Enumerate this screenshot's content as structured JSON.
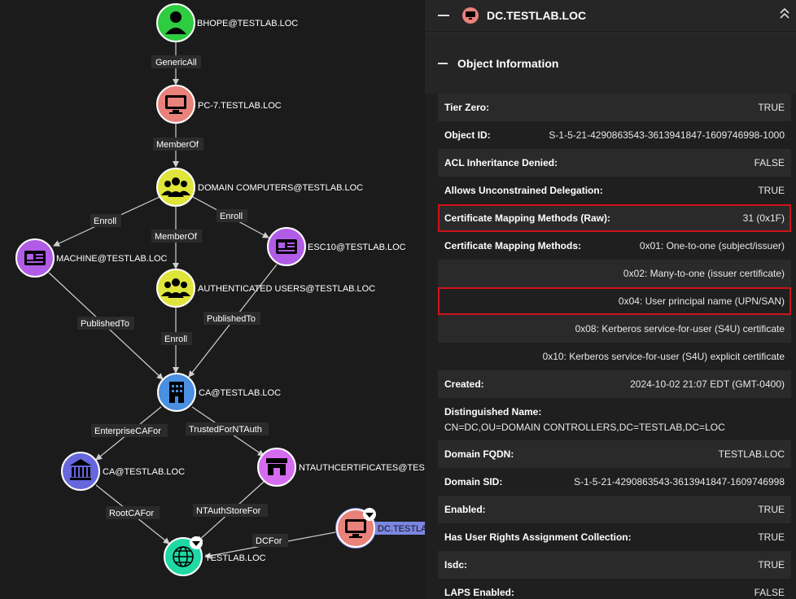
{
  "graph": {
    "nodes": [
      {
        "id": "bhope",
        "label": "BHOPE@TESTLAB.LOC",
        "icon": "user-icon",
        "color": "#2ecc40"
      },
      {
        "id": "pc7",
        "label": "PC-7.TESTLAB.LOC",
        "icon": "computer-icon",
        "color": "#e8827a"
      },
      {
        "id": "dcomp",
        "label": "DOMAIN COMPUTERS@TESTLAB.LOC",
        "icon": "group-icon",
        "color": "#dfe53a"
      },
      {
        "id": "machine",
        "label": "MACHINE@TESTLAB.LOC",
        "icon": "cert-template-icon",
        "color": "#b05ce6"
      },
      {
        "id": "esc10",
        "label": "ESC10@TESTLAB.LOC",
        "icon": "cert-template-icon",
        "color": "#b05ce6"
      },
      {
        "id": "authusers",
        "label": "AUTHENTICATED USERS@TESTLAB.LOC",
        "icon": "group-icon",
        "color": "#dfe53a"
      },
      {
        "id": "ca1",
        "label": "CA@TESTLAB.LOC",
        "icon": "enterprise-ca-icon",
        "color": "#4a8fe0"
      },
      {
        "id": "ca2",
        "label": "CA@TESTLAB.LOC",
        "icon": "root-ca-icon",
        "color": "#6666dd"
      },
      {
        "id": "ntauth",
        "label": "NTAUTHCERTIFICATES@TESTLAB.LOC",
        "icon": "ntauth-store-icon",
        "color": "#d56cf0"
      },
      {
        "id": "domain",
        "label": "TESTLAB.LOC",
        "icon": "domain-icon",
        "color": "#1fd8a4"
      },
      {
        "id": "dc",
        "label": "DC.TESTLAB.LOC",
        "icon": "computer-icon",
        "color": "#e8827a"
      }
    ],
    "edges": [
      {
        "label": "GenericAll"
      },
      {
        "label": "MemberOf"
      },
      {
        "label": "Enroll"
      },
      {
        "label": "Enroll"
      },
      {
        "label": "MemberOf"
      },
      {
        "label": "PublishedTo"
      },
      {
        "label": "PublishedTo"
      },
      {
        "label": "Enroll"
      },
      {
        "label": "EnterpriseCAFor"
      },
      {
        "label": "TrustedForNTAuth"
      },
      {
        "label": "RootCAFor"
      },
      {
        "label": "NTAuthStoreFor"
      },
      {
        "label": "DCFor"
      }
    ]
  },
  "panel": {
    "header": {
      "title": "DC.TESTLAB.LOC",
      "node_icon": "computer-icon",
      "collapse_icon": "chevron-up-double-icon"
    },
    "section": {
      "title": "Object Information"
    },
    "rows": [
      {
        "k": "Tier Zero:",
        "v": "TRUE"
      },
      {
        "k": "Object ID:",
        "v": "S-1-5-21-4290863543-3613941847-1609746998-1000"
      },
      {
        "k": "ACL Inheritance Denied:",
        "v": "FALSE"
      },
      {
        "k": "Allows Unconstrained Delegation:",
        "v": "TRUE"
      },
      {
        "k": "Certificate Mapping Methods (Raw):",
        "v": "31 (0x1F)"
      },
      {
        "k": "Certificate Mapping Methods:",
        "v": "0x01: One-to-one (subject/issuer)"
      },
      {
        "k": "",
        "v": "0x02: Many-to-one (issuer certificate)"
      },
      {
        "k": "",
        "v": "0x04: User principal name (UPN/SAN)"
      },
      {
        "k": "",
        "v": "0x08: Kerberos service-for-user (S4U) certificate"
      },
      {
        "k": "",
        "v": "0x10: Kerberos service-for-user (S4U) explicit certificate"
      },
      {
        "k": "Created:",
        "v": "2024-10-02 21:07 EDT (GMT-0400)"
      },
      {
        "k": "Distinguished Name:",
        "v": "CN=DC,OU=DOMAIN CONTROLLERS,DC=TESTLAB,DC=LOC"
      },
      {
        "k": "Domain FQDN:",
        "v": "TESTLAB.LOC"
      },
      {
        "k": "Domain SID:",
        "v": "S-1-5-21-4290863543-3613941847-1609746998"
      },
      {
        "k": "Enabled:",
        "v": "TRUE"
      },
      {
        "k": "Has User Rights Assignment Collection:",
        "v": "TRUE"
      },
      {
        "k": "Isdc:",
        "v": "TRUE"
      },
      {
        "k": "LAPS Enabled:",
        "v": "FALSE"
      }
    ],
    "highlight_color": "#d0121b"
  }
}
